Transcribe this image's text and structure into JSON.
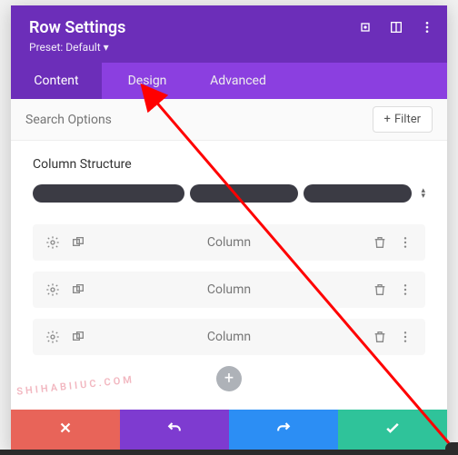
{
  "header": {
    "title": "Row Settings",
    "preset_label": "Preset: Default"
  },
  "tabs": {
    "content": "Content",
    "design": "Design",
    "advanced": "Advanced",
    "active": "content"
  },
  "search": {
    "placeholder": "Search Options",
    "filter_label": "Filter"
  },
  "section_title": "Column Structure",
  "columns": [
    {
      "label": "Column"
    },
    {
      "label": "Column"
    },
    {
      "label": "Column"
    }
  ],
  "watermark": "SHIHABIIUC.COM",
  "icons": {
    "expand": "expand-icon",
    "help": "help-icon",
    "more": "more-icon",
    "gear": "gear-icon",
    "duplicate": "duplicate-icon",
    "trash": "trash-icon",
    "row_more": "row-more-icon",
    "add": "+",
    "cancel": "×",
    "undo": "↺",
    "redo": "↻",
    "save": "✓",
    "plus": "+",
    "dropdown": "▾"
  }
}
